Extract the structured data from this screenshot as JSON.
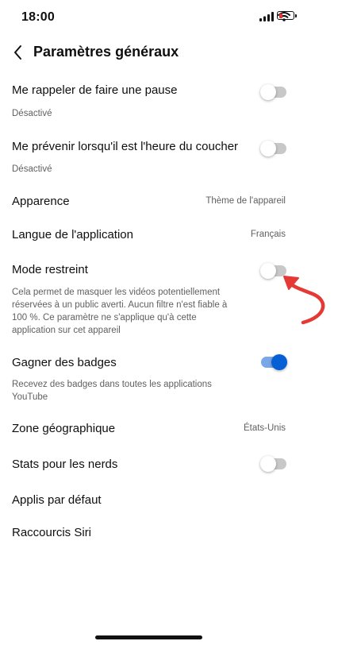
{
  "status_bar": {
    "time": "18:00"
  },
  "header": {
    "title": "Paramètres généraux"
  },
  "settings": {
    "pause_reminder": {
      "label": "Me rappeler de faire une pause",
      "status": "Désactivé",
      "on": false
    },
    "bedtime_reminder": {
      "label": "Me prévenir lorsqu'il est l'heure du coucher",
      "status": "Désactivé",
      "on": false
    },
    "appearance": {
      "label": "Apparence",
      "value": "Thème de l'appareil"
    },
    "app_language": {
      "label": "Langue de l'application",
      "value": "Français"
    },
    "restricted_mode": {
      "label": "Mode restreint",
      "description": "Cela permet de masquer les vidéos potentiellement réservées à un public averti. Aucun filtre n'est fiable à 100 %. Ce paramètre ne s'applique qu'à cette application sur cet appareil",
      "on": false
    },
    "earn_badges": {
      "label": "Gagner des badges",
      "description": "Recevez des badges dans toutes les applications YouTube",
      "on": true
    },
    "location": {
      "label": "Zone géographique",
      "value": "États-Unis"
    },
    "stats_for_nerds": {
      "label": "Stats pour les nerds",
      "on": false
    },
    "default_apps": {
      "label": "Applis par défaut"
    },
    "siri_shortcuts": {
      "label": "Raccourcis Siri"
    }
  },
  "colors": {
    "accent": "#065fd4",
    "annotation_arrow": "#e53935",
    "battery_low": "#e53935"
  }
}
